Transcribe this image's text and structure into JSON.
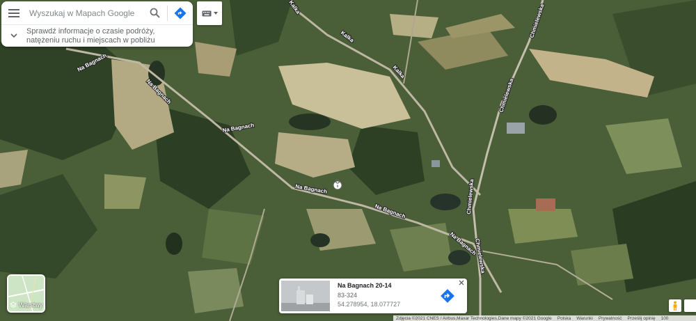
{
  "search": {
    "placeholder": "Wyszukaj w Mapach Google",
    "info_line1": "Sprawdź informacje o czasie podróży,",
    "info_line2": "natężeniu ruchu i miejscach w pobliżu"
  },
  "icons": {
    "menu": "menu-icon",
    "search": "search-icon",
    "directions": "directions-icon",
    "chevron": "chevron-down-icon",
    "keyboard": "keyboard-icon",
    "layers": "layers-icon",
    "pegman": "pegman-icon",
    "close": "close-icon"
  },
  "roads": {
    "na_bagnach": "Na Bagnach",
    "kalka": "Kalka",
    "chmielewska": "Chmielewska"
  },
  "layers": {
    "label": "Warstwy"
  },
  "card": {
    "title": "Na Bagnach 20-14",
    "postal": "83-324",
    "coords": "54.278954, 18.077727"
  },
  "footer": {
    "imagery": "Zdjęcia ©2021 CNES / Airbus,Maxar Technologies,Dane mapy ©2021 Google",
    "country": "Polska",
    "terms": "Warunki",
    "privacy": "Prywatność",
    "feedback": "Prześlij opinię",
    "scale": "100"
  },
  "colors": {
    "accent_blue": "#1a73e8",
    "field_light": "#c9c09a",
    "forest_dark": "#2f4226"
  }
}
